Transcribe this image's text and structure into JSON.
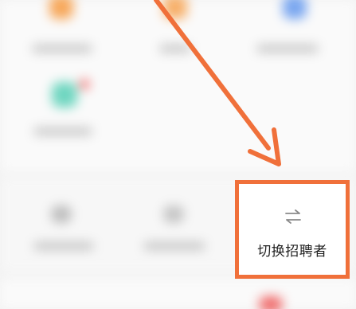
{
  "accent_color": "#f0703a",
  "switch": {
    "label": "切换招聘者",
    "icon": "swap-arrows-icon"
  },
  "annotation": {
    "arrow": "pointer-arrow",
    "highlight": "highlight-box"
  }
}
